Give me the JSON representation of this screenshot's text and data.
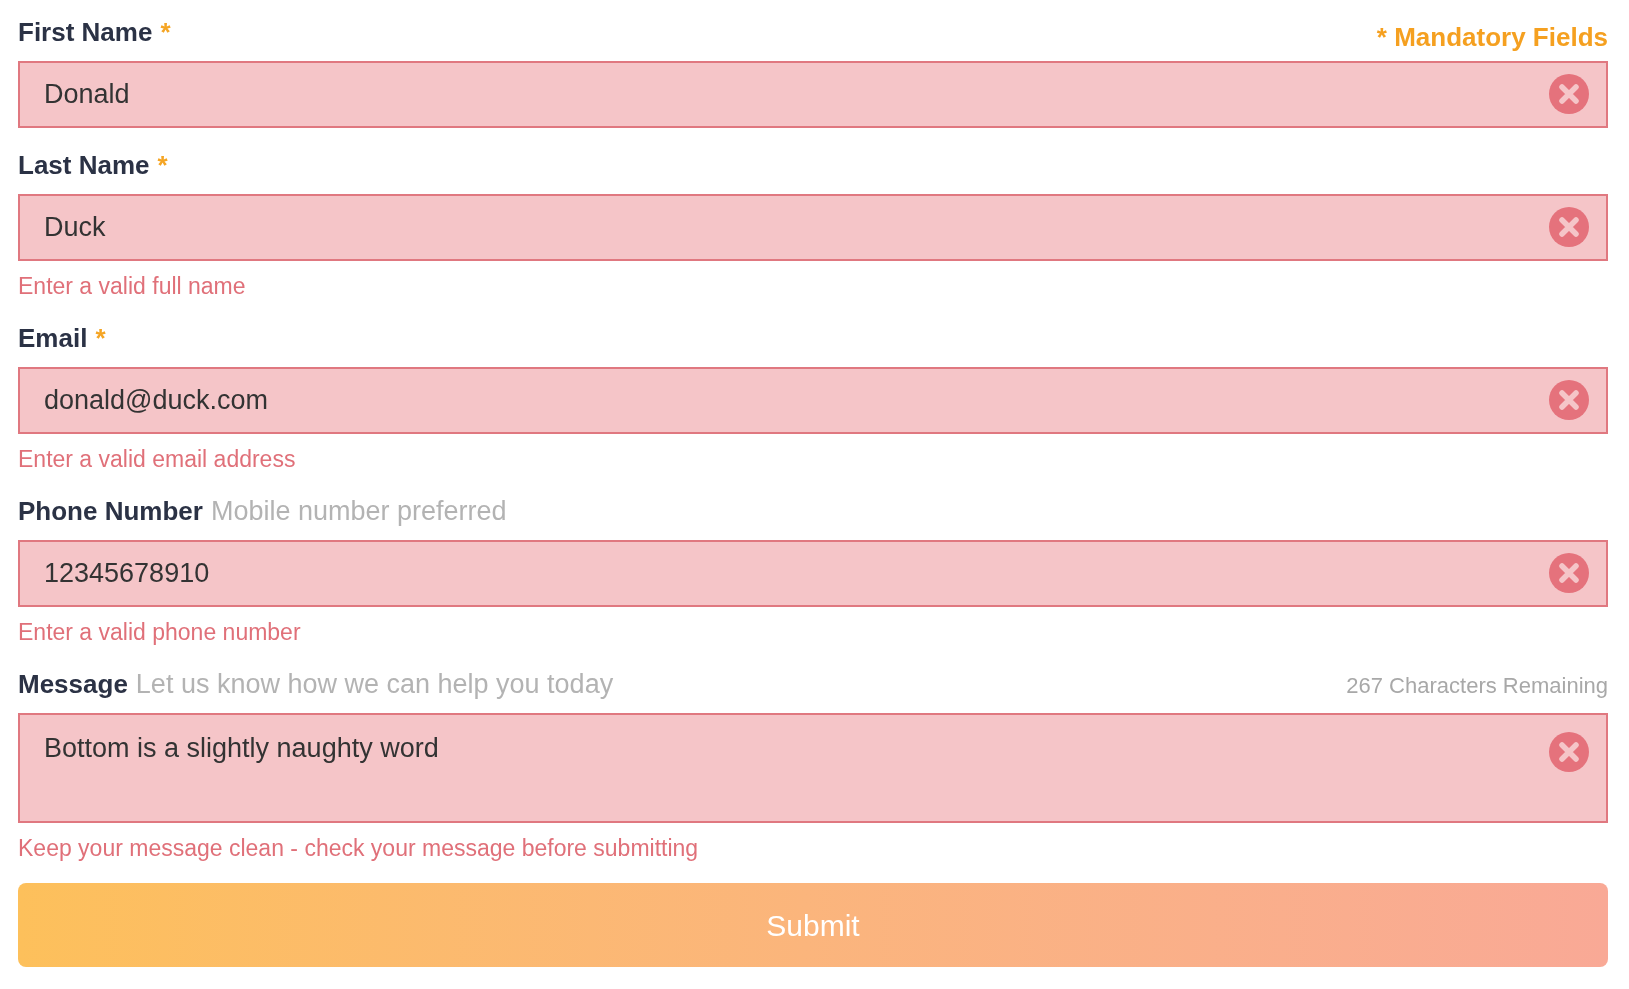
{
  "mandatory_note": "* Mandatory Fields",
  "fields": [
    {
      "kind": "input",
      "label": "First Name",
      "required_mark": "*",
      "value": "Donald",
      "invalid": true
    },
    {
      "kind": "input",
      "label": "Last Name",
      "required_mark": "*",
      "value": "Duck",
      "invalid": true,
      "error": "Enter a valid full name"
    },
    {
      "kind": "input",
      "label": "Email",
      "required_mark": "*",
      "value": "donald@duck.com",
      "invalid": true,
      "error": "Enter a valid email address"
    },
    {
      "kind": "input",
      "label": "Phone Number",
      "hint": "Mobile number preferred",
      "value": "12345678910",
      "invalid": true,
      "error": "Enter a valid phone number"
    },
    {
      "kind": "textarea",
      "label": "Message",
      "hint": "Let us know how we can help you today",
      "counter": "267 Characters Remaining",
      "value": "Bottom is a slightly naughty word",
      "invalid": true,
      "error": "Keep your message clean - check your message before submitting"
    }
  ],
  "submit": {
    "label": "Submit"
  }
}
